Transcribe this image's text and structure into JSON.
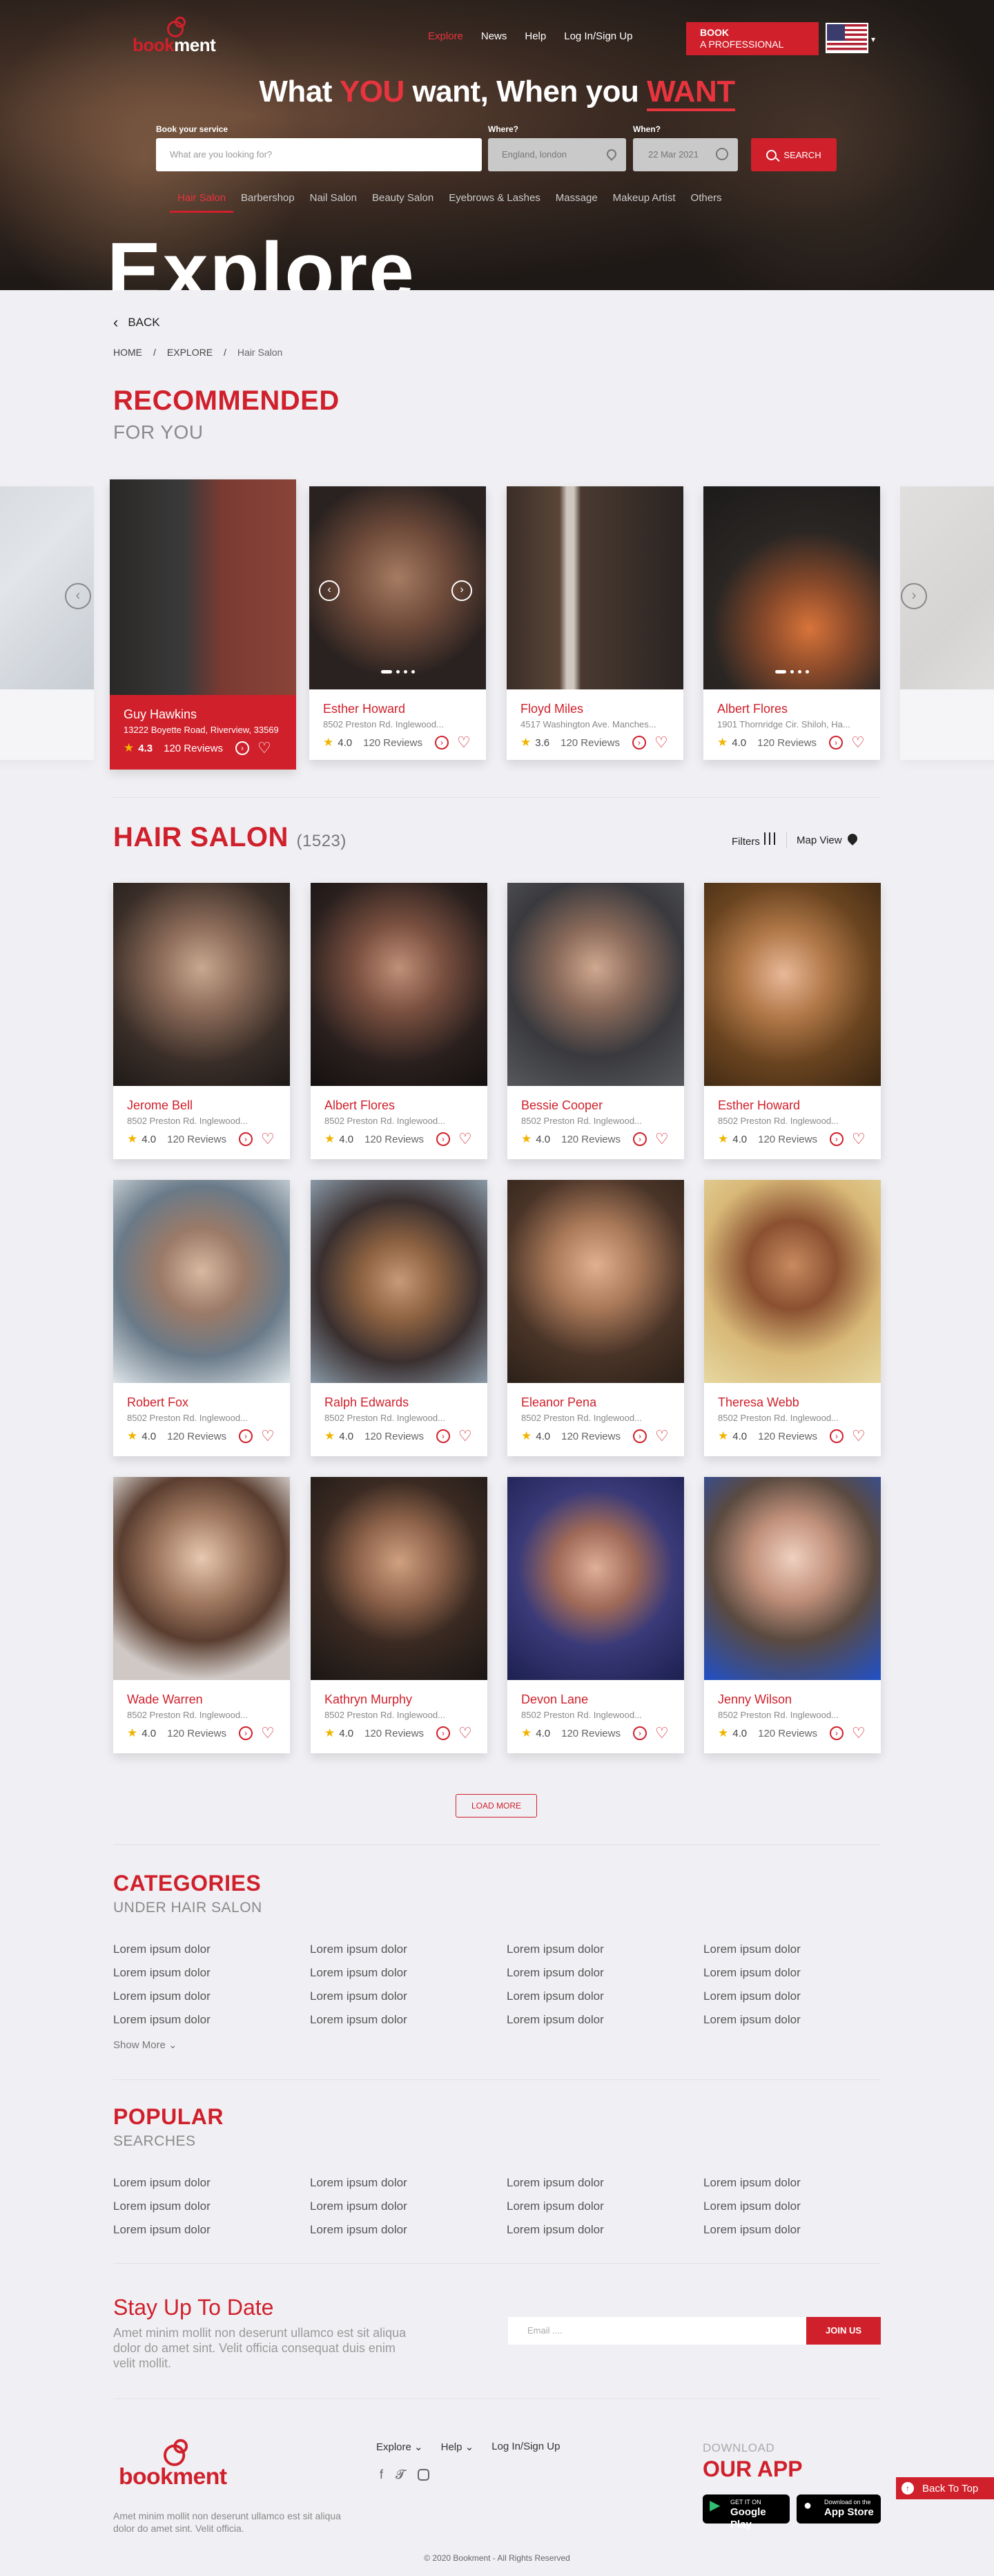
{
  "brand": {
    "logo_part1": "book",
    "logo_part2": "ment"
  },
  "header": {
    "nav": [
      "Explore",
      "News",
      "Help",
      "Log In/Sign Up"
    ],
    "book_line1": "BOOK",
    "book_line2": "A PROFESSIONAL",
    "headline": {
      "p1": "What ",
      "p2": "YOU",
      "p3": " want, When you ",
      "p4": "WANT"
    }
  },
  "search": {
    "service_label": "Book your service",
    "service_placeholder": "What are you looking for?",
    "where_label": "Where?",
    "where_value": "England, london",
    "when_label": "When?",
    "when_value": "22 Mar 2021",
    "button_label": "SEARCH"
  },
  "categories": [
    "Hair Salon",
    "Barbershop",
    "Nail Salon",
    "Beauty Salon",
    "Eyebrows & Lashes",
    "Massage",
    "Makeup Artist",
    "Others"
  ],
  "explore_title": "Explore",
  "back_label": "BACK",
  "breadcrumb": [
    "HOME",
    "/",
    "EXPLORE",
    "/",
    "Hair Salon"
  ],
  "recommended": {
    "title": "RECOMMENDED",
    "subtitle": "FOR YOU",
    "cards": [
      {
        "name": "Guy Hawkins",
        "address": "13222 Boyette Road, Riverview, 33569",
        "rating": "4.3",
        "reviews": "120 Reviews"
      },
      {
        "name": "Esther Howard",
        "address": "8502 Preston Rd. Inglewood...",
        "rating": "4.0",
        "reviews": "120 Reviews"
      },
      {
        "name": "Floyd Miles",
        "address": "4517 Washington Ave. Manches...",
        "rating": "3.6",
        "reviews": "120 Reviews"
      },
      {
        "name": "Albert Flores",
        "address": "1901 Thornridge Cir. Shiloh, Ha...",
        "rating": "4.0",
        "reviews": "120 Reviews"
      }
    ]
  },
  "hair_salon": {
    "title": "HAIR SALON",
    "count": "(1523)",
    "filters_label": "Filters",
    "map_label": "Map View",
    "cards": [
      {
        "name": "Jerome Bell",
        "address": "8502 Preston Rd. Inglewood...",
        "rating": "4.0",
        "reviews": "120 Reviews"
      },
      {
        "name": "Albert Flores",
        "address": "8502 Preston Rd. Inglewood...",
        "rating": "4.0",
        "reviews": "120 Reviews"
      },
      {
        "name": "Bessie Cooper",
        "address": "8502 Preston Rd. Inglewood...",
        "rating": "4.0",
        "reviews": "120 Reviews"
      },
      {
        "name": "Esther Howard",
        "address": "8502 Preston Rd. Inglewood...",
        "rating": "4.0",
        "reviews": "120 Reviews"
      },
      {
        "name": "Robert Fox",
        "address": "8502 Preston Rd. Inglewood...",
        "rating": "4.0",
        "reviews": "120 Reviews"
      },
      {
        "name": "Ralph Edwards",
        "address": "8502 Preston Rd. Inglewood...",
        "rating": "4.0",
        "reviews": "120 Reviews"
      },
      {
        "name": "Eleanor Pena",
        "address": "8502 Preston Rd. Inglewood...",
        "rating": "4.0",
        "reviews": "120 Reviews"
      },
      {
        "name": "Theresa Webb",
        "address": "8502 Preston Rd. Inglewood...",
        "rating": "4.0",
        "reviews": "120 Reviews"
      },
      {
        "name": "Wade Warren",
        "address": "8502 Preston Rd. Inglewood...",
        "rating": "4.0",
        "reviews": "120 Reviews"
      },
      {
        "name": "Kathryn Murphy",
        "address": "8502 Preston Rd. Inglewood...",
        "rating": "4.0",
        "reviews": "120 Reviews"
      },
      {
        "name": "Devon Lane",
        "address": "8502 Preston Rd. Inglewood...",
        "rating": "4.0",
        "reviews": "120 Reviews"
      },
      {
        "name": "Jenny Wilson",
        "address": "8502 Preston Rd. Inglewood...",
        "rating": "4.0",
        "reviews": "120 Reviews"
      }
    ],
    "load_more": "LOAD MORE"
  },
  "categories_section": {
    "title": "CATEGORIES",
    "subtitle": "UNDER HAIR SALON",
    "item_text": "Lorem ipsum dolor",
    "show_more": "Show More"
  },
  "popular": {
    "title": "POPULAR",
    "subtitle": "SEARCHES",
    "item_text": "Lorem ipsum dolor"
  },
  "newsletter": {
    "title": "Stay Up To Date",
    "text": "Amet minim mollit non deserunt ullamco est sit aliqua dolor do amet sint. Velit officia consequat duis enim velit mollit.",
    "email_placeholder": "Email ....",
    "button": "JOIN US"
  },
  "footer": {
    "nav": [
      "Explore",
      "Help",
      "Log In/Sign Up"
    ],
    "text": "Amet minim mollit non deserunt ullamco est sit aliqua dolor do amet sint. Velit officia.",
    "download": "DOWNLOAD",
    "our_app": "OUR APP",
    "google_small": "GET IT ON",
    "google_big": "Google Play",
    "apple_small": "Download on the",
    "apple_big": "App Store",
    "back_to_top": "Back To Top",
    "copyright": "© 2020 Bookment - All Rights Reserved"
  },
  "colors": {
    "accent": "#d0202b",
    "background": "#f0f0f4"
  }
}
